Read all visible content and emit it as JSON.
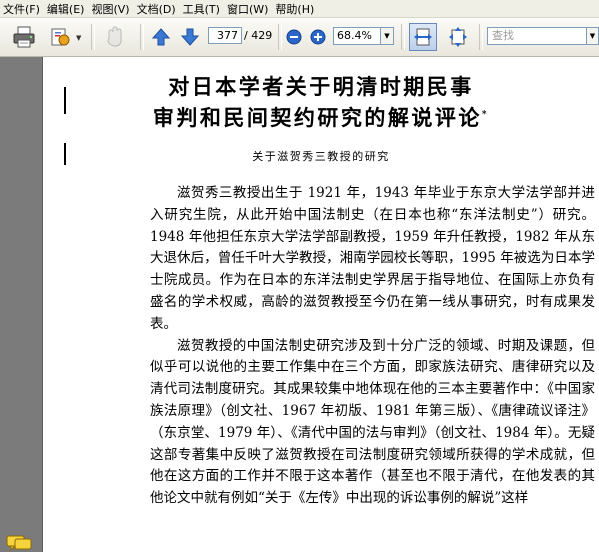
{
  "menu": [
    "文件(F)",
    "编辑(E)",
    "视图(V)",
    "文档(D)",
    "工具(T)",
    "窗口(W)",
    "帮助(H)"
  ],
  "toolbar": {
    "current_page": "377",
    "total_pages": "/ 429",
    "zoom": "68.4%",
    "search_placeholder": "查找"
  },
  "icons": [
    "print-icon",
    "organizer-icon",
    "hand-tool-icon",
    "prev-page-icon",
    "next-page-icon",
    "zoom-out-icon",
    "zoom-in-icon",
    "fit-width-icon",
    "fit-page-icon",
    "comment-icon"
  ],
  "colors": {
    "nav_arrow": "#3a78d4",
    "zoom_btn": "#2a66c9",
    "page_bg": "#ffffff",
    "workspace": "#7a7a7a"
  },
  "document": {
    "title_line1": "对日本学者关于明清时期民事",
    "title_line2": "审判和民间契约研究的解说评论",
    "title_mark": "*",
    "subtitle": "关于滋贺秀三教授的研究",
    "paragraphs": [
      "滋贺秀三教授出生于 1921 年，1943 年毕业于东京大学法学部并进入研究生院，从此开始中国法制史（在日本也称“东洋法制史”）研究。1948 年他担任东京大学法学部副教授，1959 年升任教授，1982 年从东大退休后，曾任千叶大学教授，湘南学园校长等职，1995 年被选为日本学士院成员。作为在日本的东洋法制史学界居于指导地位、在国际上亦负有盛名的学术权威，高龄的滋贺教授至今仍在第一线从事研究，时有成果发表。",
      "滋贺教授的中国法制史研究涉及到十分广泛的领域、时期及课题，但似乎可以说他的主要工作集中在三个方面，即家族法研究、唐律研究以及清代司法制度研究。其成果较集中地体现在他的三本主要著作中：《中国家族法原理》（创文社、1967 年初版、1981 年第三版）、《唐律疏议译注》（东京堂、1979 年）、《清代中国的法与审判》（创文社、1984 年）。无疑这部专著集中反映了滋贺教授在司法制度研究领域所获得的学术成就，但他在这方面的工作并不限于这本著作（甚至也不限于清代，在他发表的其他论文中就有例如“关于《左传》中出现的诉讼事例的解说”这样"
    ]
  }
}
